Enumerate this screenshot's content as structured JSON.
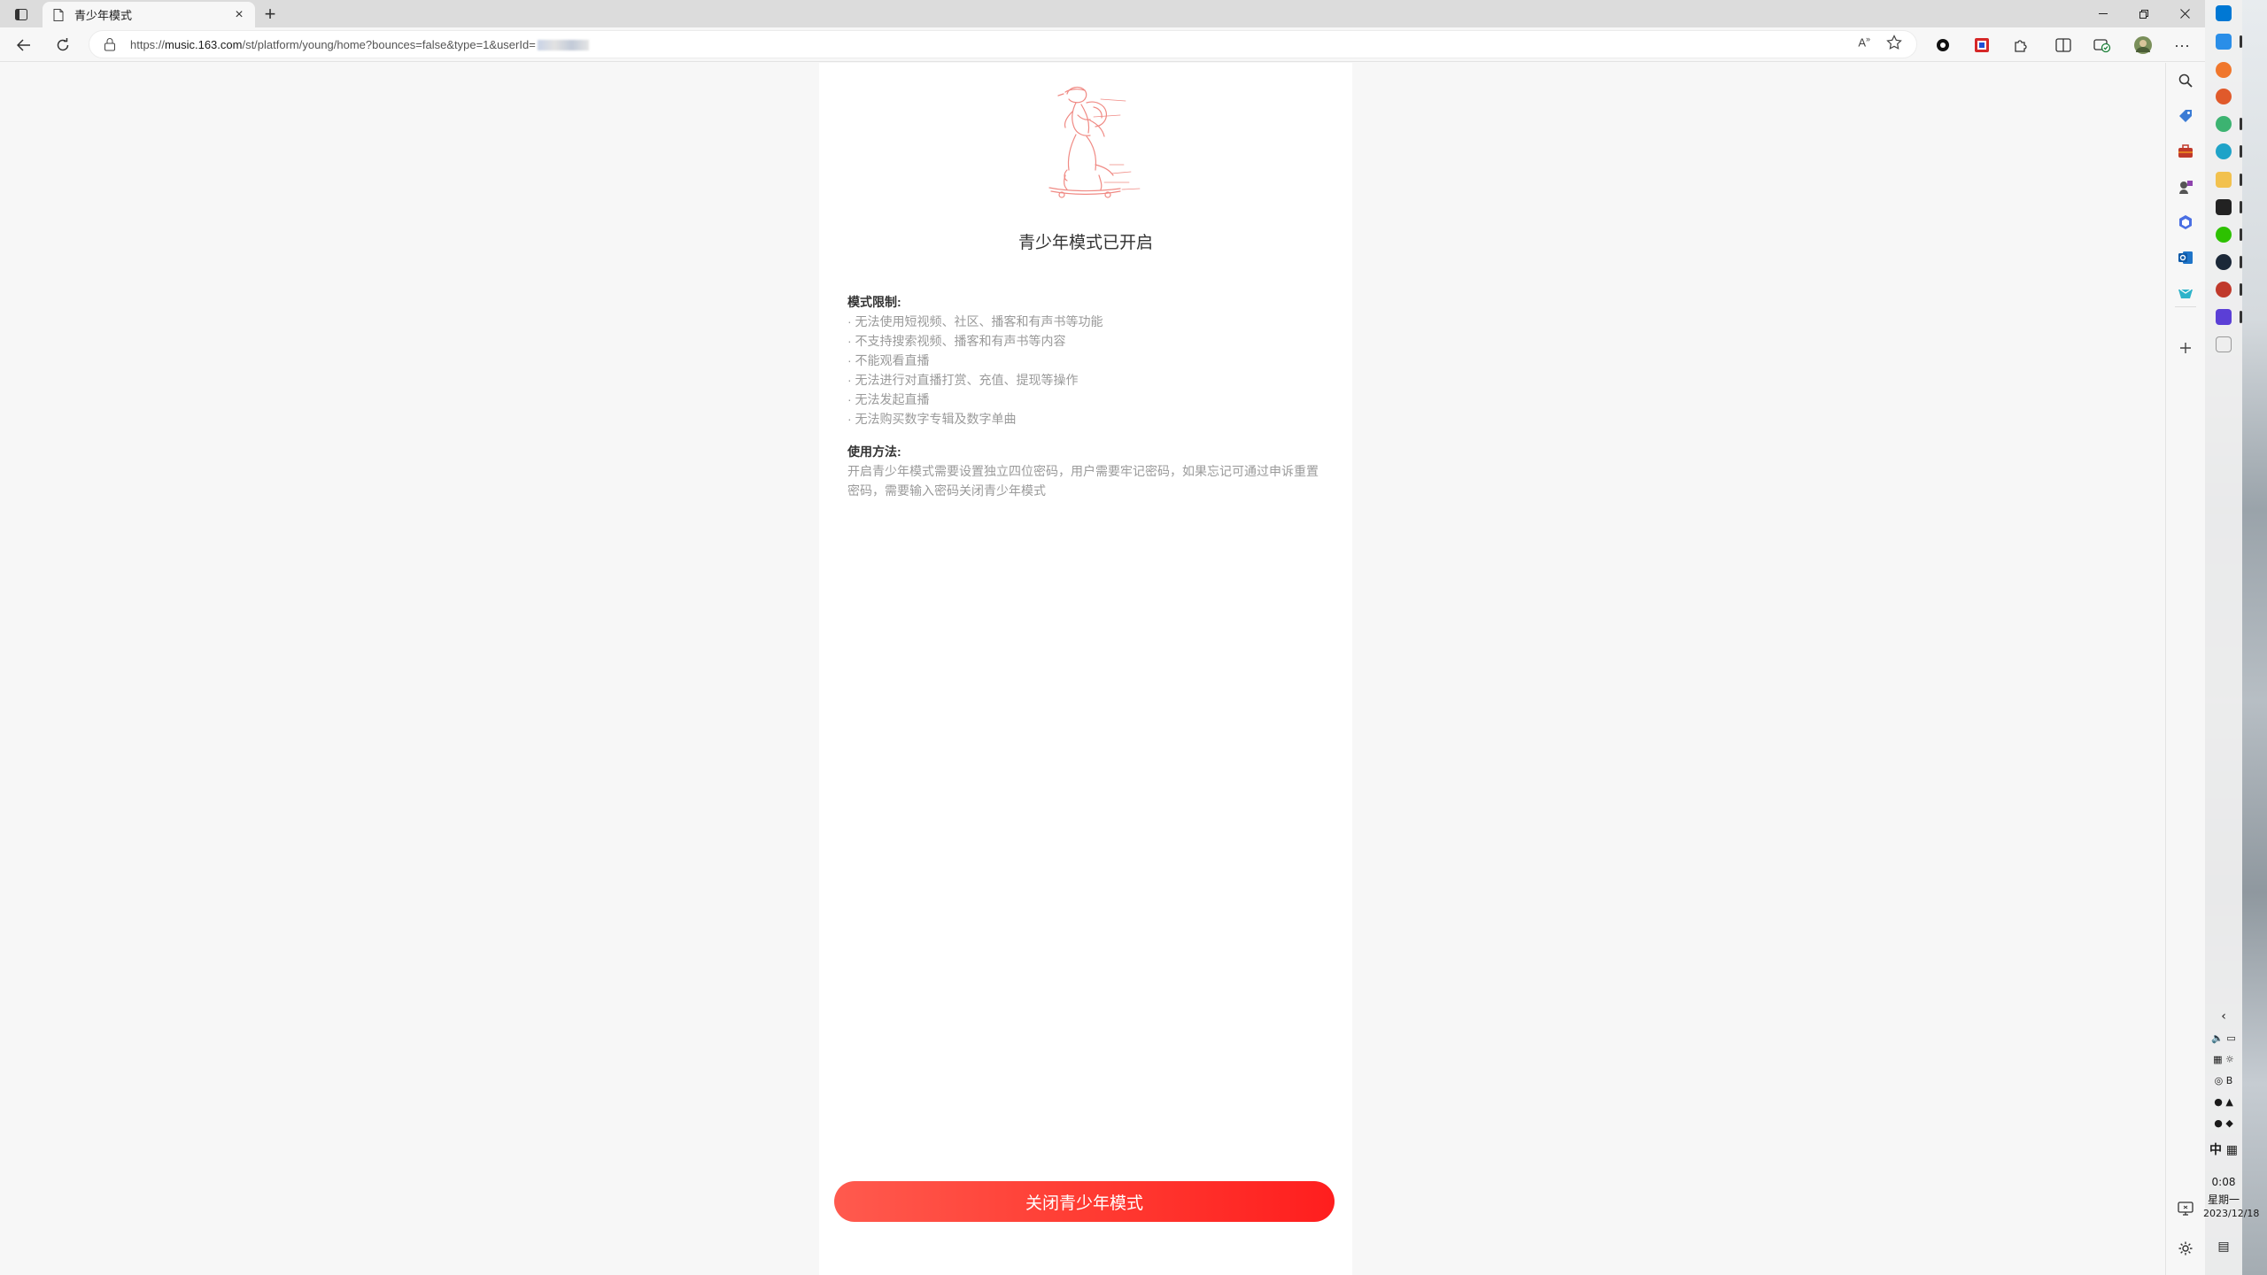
{
  "browser": {
    "tab_title": "青少年模式",
    "url_prefix": "https://",
    "url_host": "music.163.com",
    "url_path": "/st/platform/young/home?bounces=false&type=1&userId="
  },
  "page": {
    "title": "青少年模式已开启",
    "restrictions_heading": "模式限制:",
    "restrictions": [
      "· 无法使用短视频、社区、播客和有声书等功能",
      "· 不支持搜索视频、播客和有声书等内容",
      "· 不能观看直播",
      "· 无法进行对直播打赏、充值、提现等操作",
      "· 无法发起直播",
      "· 无法购买数字专辑及数字单曲"
    ],
    "usage_heading": "使用方法:",
    "usage_text": "开启青少年模式需要设置独立四位密码，用户需要牢记密码，如果忘记可通过申诉重置密码，需要输入密码关闭青少年模式",
    "close_button_label": "关闭青少年模式"
  },
  "taskbar": {
    "ime": "中",
    "time": "0:08",
    "weekday": "星期一",
    "date": "2023/12/18"
  },
  "colors": {
    "cta_start": "#ff5a4e",
    "cta_end": "#ff1e1e",
    "illustration": "#f08a84"
  }
}
